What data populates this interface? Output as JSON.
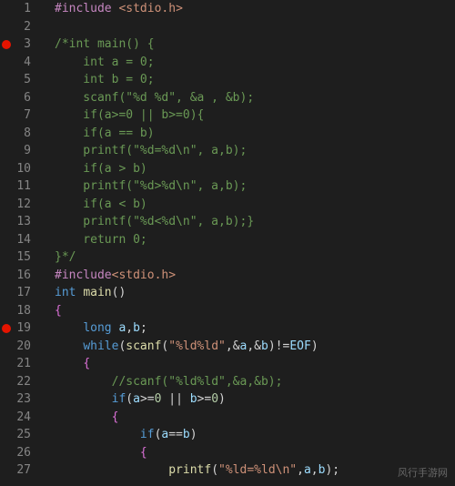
{
  "editor": {
    "lineNumbers": [
      "1",
      "2",
      "3",
      "4",
      "5",
      "6",
      "7",
      "8",
      "9",
      "10",
      "11",
      "12",
      "13",
      "14",
      "15",
      "16",
      "17",
      "18",
      "19",
      "20",
      "21",
      "22",
      "23",
      "24",
      "25",
      "26",
      "27"
    ],
    "breakpoints": [
      3,
      19
    ],
    "lines": [
      [
        {
          "t": "#include",
          "c": "tok-pre"
        },
        {
          "t": " ",
          "c": ""
        },
        {
          "t": "<stdio.h>",
          "c": "tok-inc"
        }
      ],
      [],
      [
        {
          "t": "/*int main() {",
          "c": "tok-com"
        }
      ],
      [
        {
          "t": "    int a = 0;",
          "c": "tok-com"
        }
      ],
      [
        {
          "t": "    int b = 0;",
          "c": "tok-com"
        }
      ],
      [
        {
          "t": "    scanf(\"%d %d\", &a , &b);",
          "c": "tok-com"
        }
      ],
      [
        {
          "t": "    if(a>=0 || b>=0){",
          "c": "tok-com"
        }
      ],
      [
        {
          "t": "    if(a == b)",
          "c": "tok-com"
        }
      ],
      [
        {
          "t": "    printf(\"%d=%d\\n\", a,b);",
          "c": "tok-com"
        }
      ],
      [
        {
          "t": "    if(a > b)",
          "c": "tok-com"
        }
      ],
      [
        {
          "t": "    printf(\"%d>%d\\n\", a,b);",
          "c": "tok-com"
        }
      ],
      [
        {
          "t": "    if(a < b)",
          "c": "tok-com"
        }
      ],
      [
        {
          "t": "    printf(\"%d<%d\\n\", a,b);}",
          "c": "tok-com"
        }
      ],
      [
        {
          "t": "    return 0;",
          "c": "tok-com"
        }
      ],
      [
        {
          "t": "}*/",
          "c": "tok-com"
        }
      ],
      [
        {
          "t": "#include",
          "c": "tok-pre"
        },
        {
          "t": "<stdio.h>",
          "c": "tok-inc"
        }
      ],
      [
        {
          "t": "int",
          "c": "tok-type"
        },
        {
          "t": " ",
          "c": ""
        },
        {
          "t": "main",
          "c": "tok-fn"
        },
        {
          "t": "()",
          "c": "tok-punc"
        }
      ],
      [
        {
          "t": "{",
          "c": "tok-brace"
        }
      ],
      [
        {
          "t": "    ",
          "c": ""
        },
        {
          "t": "long",
          "c": "tok-type"
        },
        {
          "t": " ",
          "c": ""
        },
        {
          "t": "a",
          "c": "tok-var"
        },
        {
          "t": ",",
          "c": "tok-punc"
        },
        {
          "t": "b",
          "c": "tok-var"
        },
        {
          "t": ";",
          "c": "tok-punc"
        }
      ],
      [
        {
          "t": "    ",
          "c": ""
        },
        {
          "t": "while",
          "c": "tok-kw"
        },
        {
          "t": "(",
          "c": "tok-punc"
        },
        {
          "t": "scanf",
          "c": "tok-fn"
        },
        {
          "t": "(",
          "c": "tok-punc"
        },
        {
          "t": "\"%ld%ld\"",
          "c": "tok-str"
        },
        {
          "t": ",&",
          "c": "tok-punc"
        },
        {
          "t": "a",
          "c": "tok-var"
        },
        {
          "t": ",&",
          "c": "tok-punc"
        },
        {
          "t": "b",
          "c": "tok-var"
        },
        {
          "t": ")!=",
          "c": "tok-punc"
        },
        {
          "t": "EOF",
          "c": "tok-var"
        },
        {
          "t": ")",
          "c": "tok-punc"
        }
      ],
      [
        {
          "t": "    ",
          "c": ""
        },
        {
          "t": "{",
          "c": "tok-brace"
        }
      ],
      [
        {
          "t": "        ",
          "c": ""
        },
        {
          "t": "//scanf(\"%ld%ld\",&a,&b);",
          "c": "tok-com"
        }
      ],
      [
        {
          "t": "        ",
          "c": ""
        },
        {
          "t": "if",
          "c": "tok-kw"
        },
        {
          "t": "(",
          "c": "tok-punc"
        },
        {
          "t": "a",
          "c": "tok-var"
        },
        {
          "t": ">=",
          "c": "tok-op"
        },
        {
          "t": "0",
          "c": "tok-num"
        },
        {
          "t": " || ",
          "c": "tok-op"
        },
        {
          "t": "b",
          "c": "tok-var"
        },
        {
          "t": ">=",
          "c": "tok-op"
        },
        {
          "t": "0",
          "c": "tok-num"
        },
        {
          "t": ")",
          "c": "tok-punc"
        }
      ],
      [
        {
          "t": "        ",
          "c": ""
        },
        {
          "t": "{",
          "c": "tok-brace"
        }
      ],
      [
        {
          "t": "            ",
          "c": ""
        },
        {
          "t": "if",
          "c": "tok-kw"
        },
        {
          "t": "(",
          "c": "tok-punc"
        },
        {
          "t": "a",
          "c": "tok-var"
        },
        {
          "t": "==",
          "c": "tok-op"
        },
        {
          "t": "b",
          "c": "tok-var"
        },
        {
          "t": ")",
          "c": "tok-punc"
        }
      ],
      [
        {
          "t": "            ",
          "c": ""
        },
        {
          "t": "{",
          "c": "tok-brace"
        }
      ],
      [
        {
          "t": "                ",
          "c": ""
        },
        {
          "t": "printf",
          "c": "tok-fn"
        },
        {
          "t": "(",
          "c": "tok-punc"
        },
        {
          "t": "\"%ld=%ld\\n\"",
          "c": "tok-str"
        },
        {
          "t": ",",
          "c": "tok-punc"
        },
        {
          "t": "a",
          "c": "tok-var"
        },
        {
          "t": ",",
          "c": "tok-punc"
        },
        {
          "t": "b",
          "c": "tok-var"
        },
        {
          "t": ");",
          "c": "tok-punc"
        }
      ]
    ]
  },
  "watermark": "风行手游网"
}
